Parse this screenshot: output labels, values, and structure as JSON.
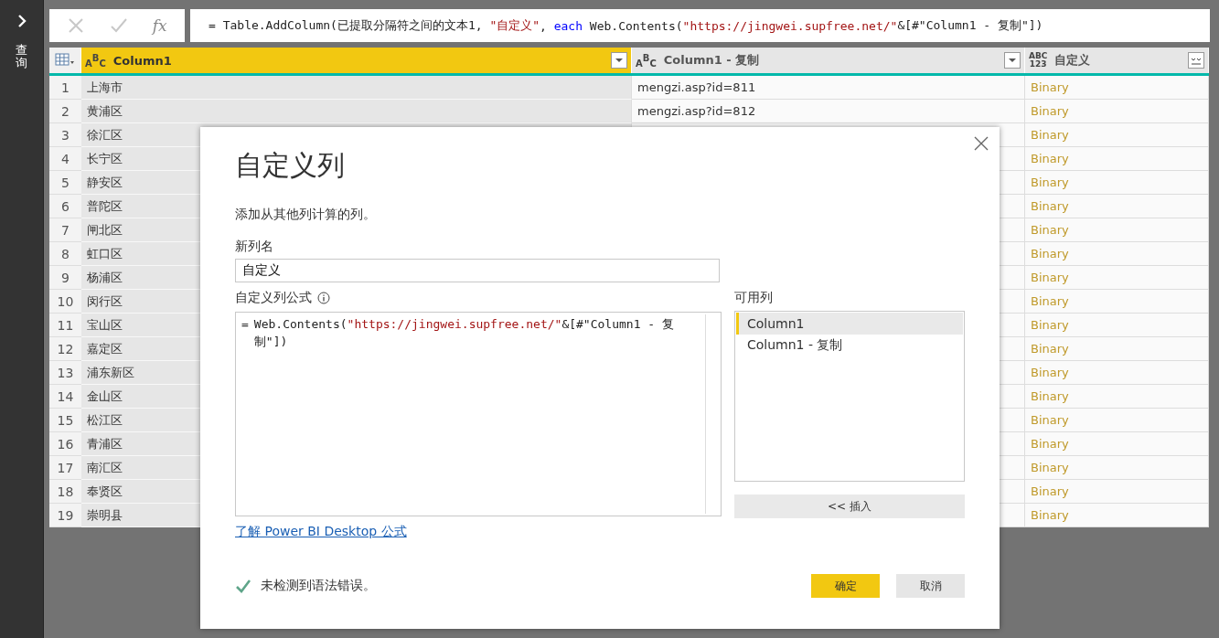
{
  "sidebar": {
    "label": "查询"
  },
  "formula_bar": {
    "fx": "fx",
    "formula": [
      {
        "kind": "plain",
        "text": "= Table.AddColumn(已提取分隔符之间的文本1, "
      },
      {
        "kind": "string",
        "text": "\"自定义\""
      },
      {
        "kind": "plain",
        "text": ", "
      },
      {
        "kind": "keyword",
        "text": "each"
      },
      {
        "kind": "plain",
        "text": " Web.Contents("
      },
      {
        "kind": "string",
        "text": "\"https://jingwei.supfree.net/\""
      },
      {
        "kind": "plain",
        "text": "&[#\"Column1 - 复制\"])"
      }
    ]
  },
  "table": {
    "columns": [
      {
        "name": "Column1",
        "selected": true,
        "type_badge": {
          "kind": "staggered",
          "parts": [
            "A",
            "B",
            "C"
          ]
        },
        "kind": "text"
      },
      {
        "name": "Column1 - 复制",
        "selected": false,
        "type_badge": {
          "kind": "staggered",
          "parts": [
            "A",
            "B",
            "C"
          ]
        },
        "kind": "text"
      },
      {
        "name": "自定义",
        "selected": false,
        "type_badge": {
          "kind": "stacked",
          "parts": [
            "ABC",
            "123"
          ]
        },
        "kind": "binary"
      }
    ],
    "rows": [
      {
        "number": "1",
        "cells": [
          "上海市",
          "mengzi.asp?id=811",
          "Binary"
        ]
      },
      {
        "number": "2",
        "cells": [
          "黄浦区",
          "mengzi.asp?id=812",
          "Binary"
        ]
      },
      {
        "number": "3",
        "cells": [
          "徐汇区",
          null,
          "Binary"
        ]
      },
      {
        "number": "4",
        "cells": [
          "长宁区",
          null,
          "Binary"
        ]
      },
      {
        "number": "5",
        "cells": [
          "静安区",
          null,
          "Binary"
        ]
      },
      {
        "number": "6",
        "cells": [
          "普陀区",
          null,
          "Binary"
        ]
      },
      {
        "number": "7",
        "cells": [
          "闸北区",
          null,
          "Binary"
        ]
      },
      {
        "number": "8",
        "cells": [
          "虹口区",
          null,
          "Binary"
        ]
      },
      {
        "number": "9",
        "cells": [
          "杨浦区",
          null,
          "Binary"
        ]
      },
      {
        "number": "10",
        "cells": [
          "闵行区",
          null,
          "Binary"
        ]
      },
      {
        "number": "11",
        "cells": [
          "宝山区",
          null,
          "Binary"
        ]
      },
      {
        "number": "12",
        "cells": [
          "嘉定区",
          null,
          "Binary"
        ]
      },
      {
        "number": "13",
        "cells": [
          "浦东新区",
          null,
          "Binary"
        ]
      },
      {
        "number": "14",
        "cells": [
          "金山区",
          null,
          "Binary"
        ]
      },
      {
        "number": "15",
        "cells": [
          "松江区",
          null,
          "Binary"
        ]
      },
      {
        "number": "16",
        "cells": [
          "青浦区",
          null,
          "Binary"
        ]
      },
      {
        "number": "17",
        "cells": [
          "南汇区",
          null,
          "Binary"
        ]
      },
      {
        "number": "18",
        "cells": [
          "奉贤区",
          null,
          "Binary"
        ]
      },
      {
        "number": "19",
        "cells": [
          "崇明县",
          null,
          "Binary"
        ]
      }
    ]
  },
  "dialog": {
    "title": "自定义列",
    "description": "添加从其他列计算的列。",
    "name_label": "新列名",
    "name_value": "自定义",
    "formula_label": "自定义列公式",
    "formula": [
      {
        "kind": "plain",
        "text": "Web.Contents("
      },
      {
        "kind": "string",
        "text": "\"https://jingwei.supfree.net/\""
      },
      {
        "kind": "plain",
        "text": "&[#\"Column1 - 复制\"])"
      }
    ],
    "formula_prefix": "=",
    "available_label": "可用列",
    "available_columns": [
      {
        "label": "Column1",
        "selected": true
      },
      {
        "label": "Column1 - 复制",
        "selected": false
      }
    ],
    "insert_button": "<< 插入",
    "link": "了解 Power BI Desktop 公式",
    "status": {
      "ok": true,
      "text": "未检测到语法错误。"
    },
    "buttons": [
      {
        "label": "确定",
        "kind": "primary"
      },
      {
        "label": "取消",
        "kind": "secondary"
      }
    ]
  }
}
